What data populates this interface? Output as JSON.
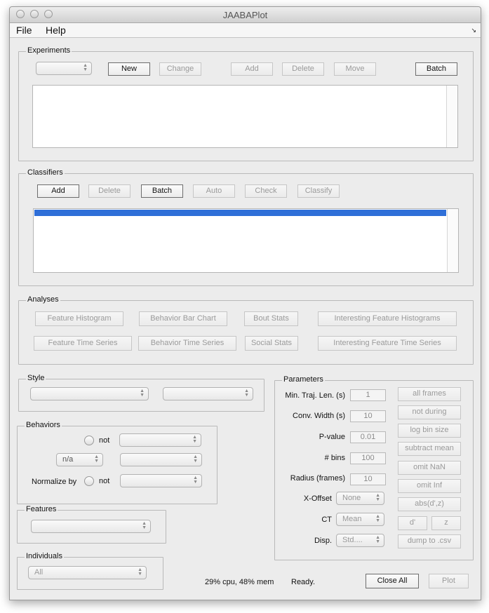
{
  "window": {
    "title": "JAABAPlot"
  },
  "menubar": {
    "file": "File",
    "help": "Help",
    "corner_icon": "resize-corner-icon"
  },
  "experiments": {
    "title": "Experiments",
    "select_value": "",
    "buttons": {
      "new": "New",
      "change": "Change",
      "add": "Add",
      "delete": "Delete",
      "move": "Move",
      "batch": "Batch"
    }
  },
  "classifiers": {
    "title": "Classifiers",
    "buttons": {
      "add": "Add",
      "delete": "Delete",
      "batch": "Batch",
      "auto": "Auto",
      "check": "Check",
      "classify": "Classify"
    },
    "selection_color": "#2f6fd8"
  },
  "analyses": {
    "title": "Analyses",
    "buttons": {
      "feature_histogram": "Feature Histogram",
      "behavior_bar_chart": "Behavior Bar Chart",
      "bout_stats": "Bout Stats",
      "interesting_feature_histograms": "Interesting Feature Histograms",
      "feature_time_series": "Feature Time Series",
      "behavior_time_series": "Behavior Time Series",
      "social_stats": "Social Stats",
      "interesting_feature_time_series": "Interesting Feature Time Series"
    }
  },
  "style": {
    "title": "Style",
    "select1": "",
    "select2": ""
  },
  "behaviors": {
    "title": "Behaviors",
    "not1": "not",
    "na": "n/a",
    "normalize_by": "Normalize by",
    "not2": "not"
  },
  "features": {
    "title": "Features",
    "select": ""
  },
  "individuals": {
    "title": "Individuals",
    "select": "All"
  },
  "parameters": {
    "title": "Parameters",
    "min_traj_len_label": "Min. Traj. Len. (s)",
    "min_traj_len_value": "1",
    "conv_width_label": "Conv. Width (s)",
    "conv_width_value": "10",
    "pvalue_label": "P-value",
    "pvalue_value": "0.01",
    "nbins_label": "# bins",
    "nbins_value": "100",
    "radius_label": "Radius (frames)",
    "radius_value": "10",
    "xoffset_label": "X-Offset",
    "xoffset_value": "None",
    "ct_label": "CT",
    "ct_value": "Mean",
    "disp_label": "Disp.",
    "disp_value": "Std....",
    "toggles": {
      "all_frames": "all frames",
      "not_during": "not during",
      "log_bin_size": "log bin size",
      "subtract_mean": "subtract mean",
      "omit_nan": "omit NaN",
      "omit_inf": "omit Inf",
      "abs_dprime": "abs(d',z)",
      "dprime": "d'",
      "z": "z",
      "dump_csv": "dump to .csv"
    }
  },
  "status": {
    "cpu_mem": "29% cpu, 48% mem",
    "state": "Ready."
  },
  "footer": {
    "close_all": "Close All",
    "plot": "Plot"
  }
}
